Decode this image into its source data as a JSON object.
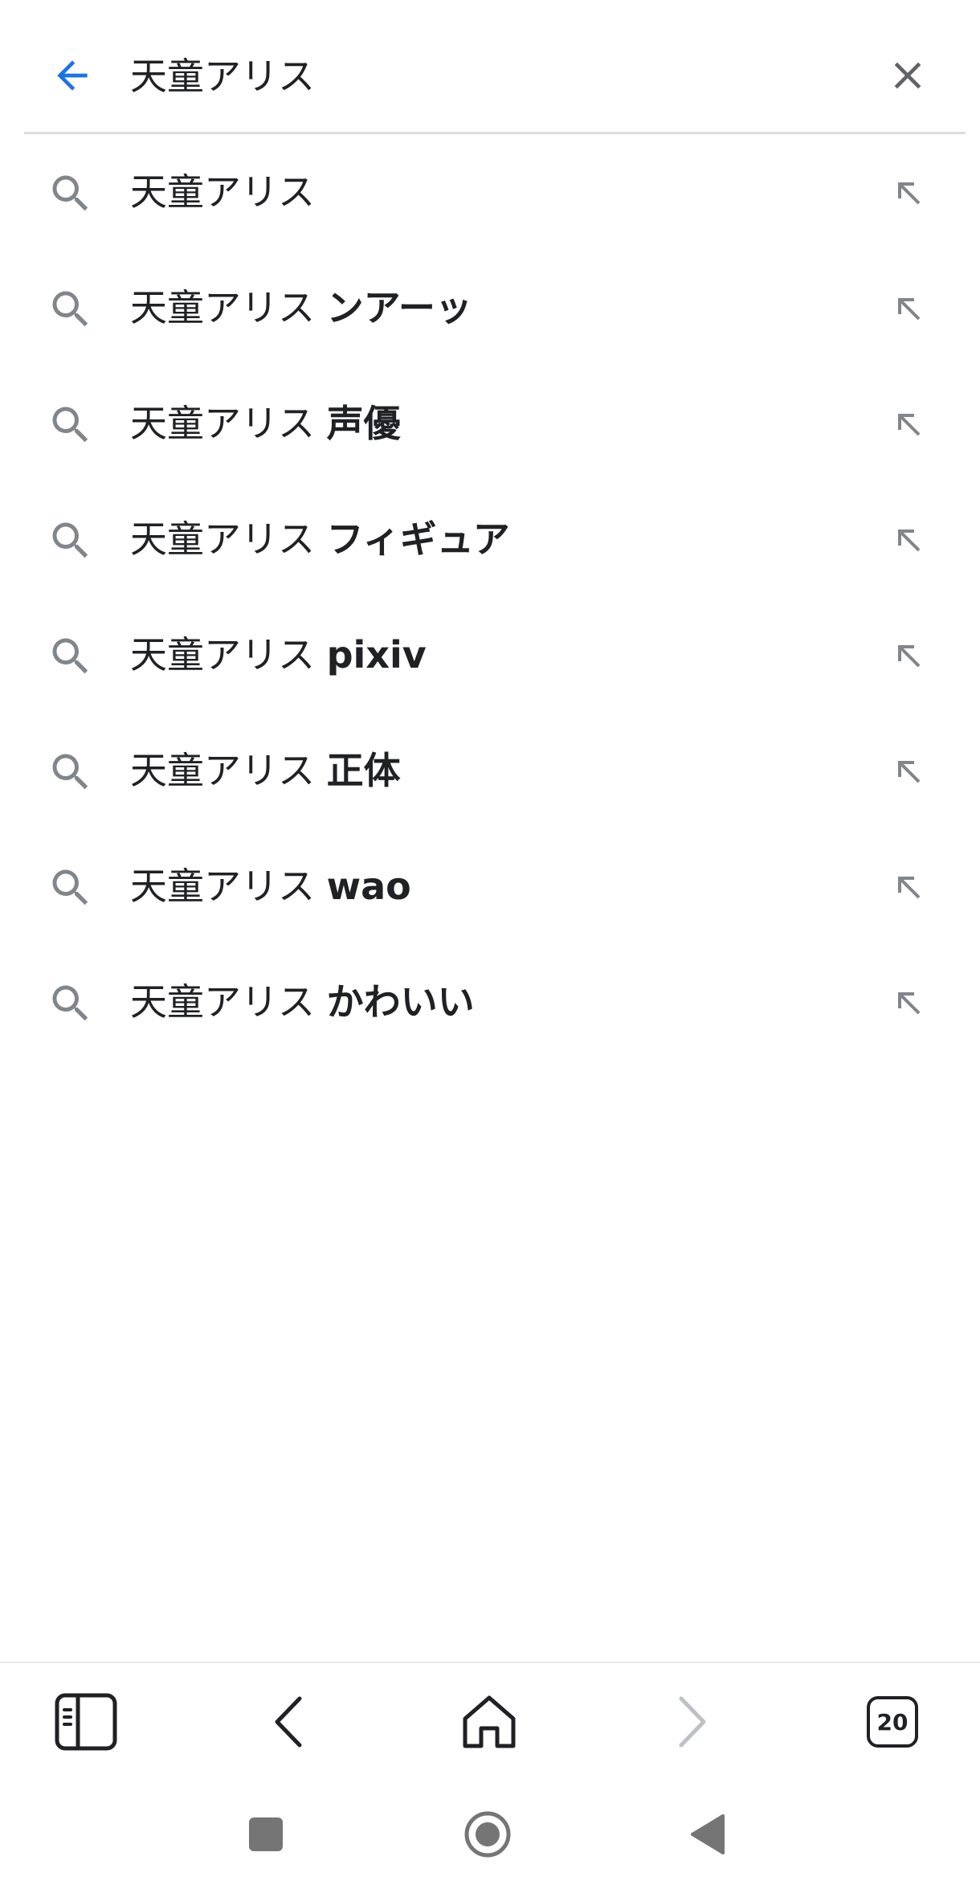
{
  "search": {
    "query": "天童アリス",
    "back_icon": "arrow-left-icon",
    "clear_icon": "close-icon",
    "accent_color": "#1a73e8"
  },
  "suggestions": [
    {
      "prefix": "天童アリス",
      "suffix": ""
    },
    {
      "prefix": "天童アリス ",
      "suffix": "ンアーッ"
    },
    {
      "prefix": "天童アリス ",
      "suffix": "声優"
    },
    {
      "prefix": "天童アリス ",
      "suffix": "フィギュア"
    },
    {
      "prefix": "天童アリス ",
      "suffix": "pixiv"
    },
    {
      "prefix": "天童アリス ",
      "suffix": "正体"
    },
    {
      "prefix": "天童アリス ",
      "suffix": "wao"
    },
    {
      "prefix": "天童アリス ",
      "suffix": "かわいい"
    }
  ],
  "toolbar": {
    "tab_count": "20"
  },
  "icons": {
    "suggestion_icon": "search-icon",
    "fill_icon": "arrow-up-left-icon",
    "sidebar": "sidebar-icon",
    "back": "chevron-left-icon",
    "home": "home-icon",
    "forward": "chevron-right-icon",
    "tabs": "tabs-icon",
    "recents": "square-icon",
    "system_home": "circle-icon",
    "system_back": "triangle-icon"
  },
  "colors": {
    "text": "#202124",
    "icon_gray": "#80868b",
    "disabled": "#bdc1c6",
    "nav_gray": "#757575"
  }
}
